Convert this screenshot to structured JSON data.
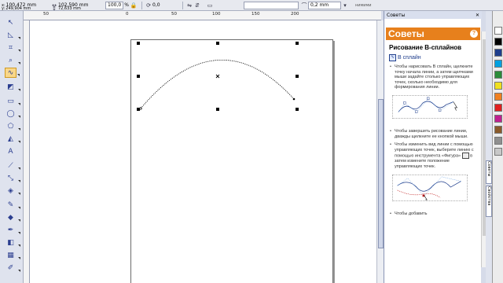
{
  "property_bar": {
    "x_value": "100,472 mm",
    "y_value": "249,904 mm",
    "width_value": "102,590 mm",
    "height_value": "72,633 mm",
    "scale_x": "100,0",
    "scale_y": "100,0",
    "percent": "%",
    "rotation": "0,0",
    "outline_width": "0,2 mm",
    "right_label": "нимими"
  },
  "ruler": {
    "top_labels": [
      "50",
      "0",
      "50",
      "100",
      "150",
      "200"
    ]
  },
  "docker": {
    "header_title": "Советы",
    "title": "Советы",
    "section_title": "Рисование B-сплайнов",
    "subsection_label": "B сплайн",
    "bullets": [
      "Чтобы нарисовать B сплайн, щелкните точку начала линии, а затем щелчками мыши задайте столько управляющих точек, сколько необходимо для формирования линии.",
      "Чтобы завершить рисование линии, дважды щелкните ее кнопкой мыши.",
      "Чтобы изменить вид линии с помощью управляющих точек, выберите линию с помощью инструмента «Фигура»",
      "в затем измените положение управляющих точек.",
      "Чтобы добавить"
    ]
  },
  "side_tabs": [
    "Советы",
    "Свойства"
  ],
  "colors": {
    "accent": "#e7801c",
    "selection": "#000000",
    "palette": [
      "#ffffff",
      "#000000",
      "#1f3e8c",
      "#00a0e0",
      "#2b8c3a",
      "#f0e020",
      "#f08020",
      "#e02020",
      "#c02090",
      "#8a5a2a",
      "#909090",
      "#c8c8c8"
    ]
  },
  "icons": [
    "pick-tool-icon",
    "shape-tool-icon",
    "crop-tool-icon",
    "zoom-tool-icon",
    "freehand-tool-icon",
    "smart-fill-icon",
    "rectangle-tool-icon",
    "ellipse-tool-icon",
    "polygon-tool-icon",
    "text-tool-icon",
    "parallel-dimension-icon",
    "connector-icon",
    "blend-icon",
    "eyedropper-icon",
    "outline-pen-icon",
    "fill-icon",
    "interactive-fill-icon",
    "help-icon",
    "close-icon"
  ]
}
